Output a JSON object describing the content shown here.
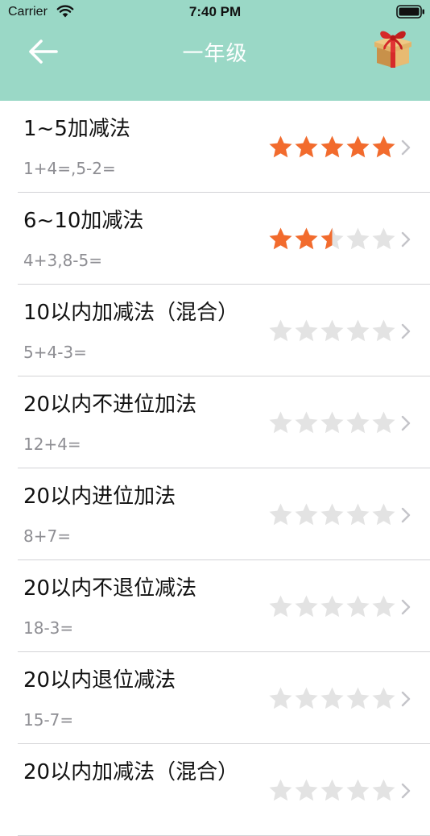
{
  "status_bar": {
    "carrier": "Carrier",
    "time": "7:40 PM"
  },
  "nav": {
    "title": "一年级",
    "back_icon": "arrow-left-icon",
    "gift_icon": "gift-box-icon"
  },
  "colors": {
    "header_bg": "#9ad8c6",
    "star_filled": "#f26b2d",
    "star_empty": "#e3e3e3",
    "title_text": "#111111",
    "sample_text": "#8e8e93"
  },
  "rating_max": 5,
  "lessons": [
    {
      "title": "1~5加减法",
      "sample": "1+4=,5-2=",
      "stars": 5
    },
    {
      "title": "6~10加减法",
      "sample": "4+3,8-5=",
      "stars": 2.5
    },
    {
      "title": "10以内加减法（混合）",
      "sample": "5+4-3=",
      "stars": 0
    },
    {
      "title": "20以内不进位加法",
      "sample": "12+4=",
      "stars": 0
    },
    {
      "title": "20以内进位加法",
      "sample": "8+7=",
      "stars": 0
    },
    {
      "title": "20以内不退位减法",
      "sample": "18-3=",
      "stars": 0
    },
    {
      "title": "20以内退位减法",
      "sample": "15-7=",
      "stars": 0
    },
    {
      "title": "20以内加减法（混合）",
      "sample": "",
      "stars": 0
    }
  ]
}
